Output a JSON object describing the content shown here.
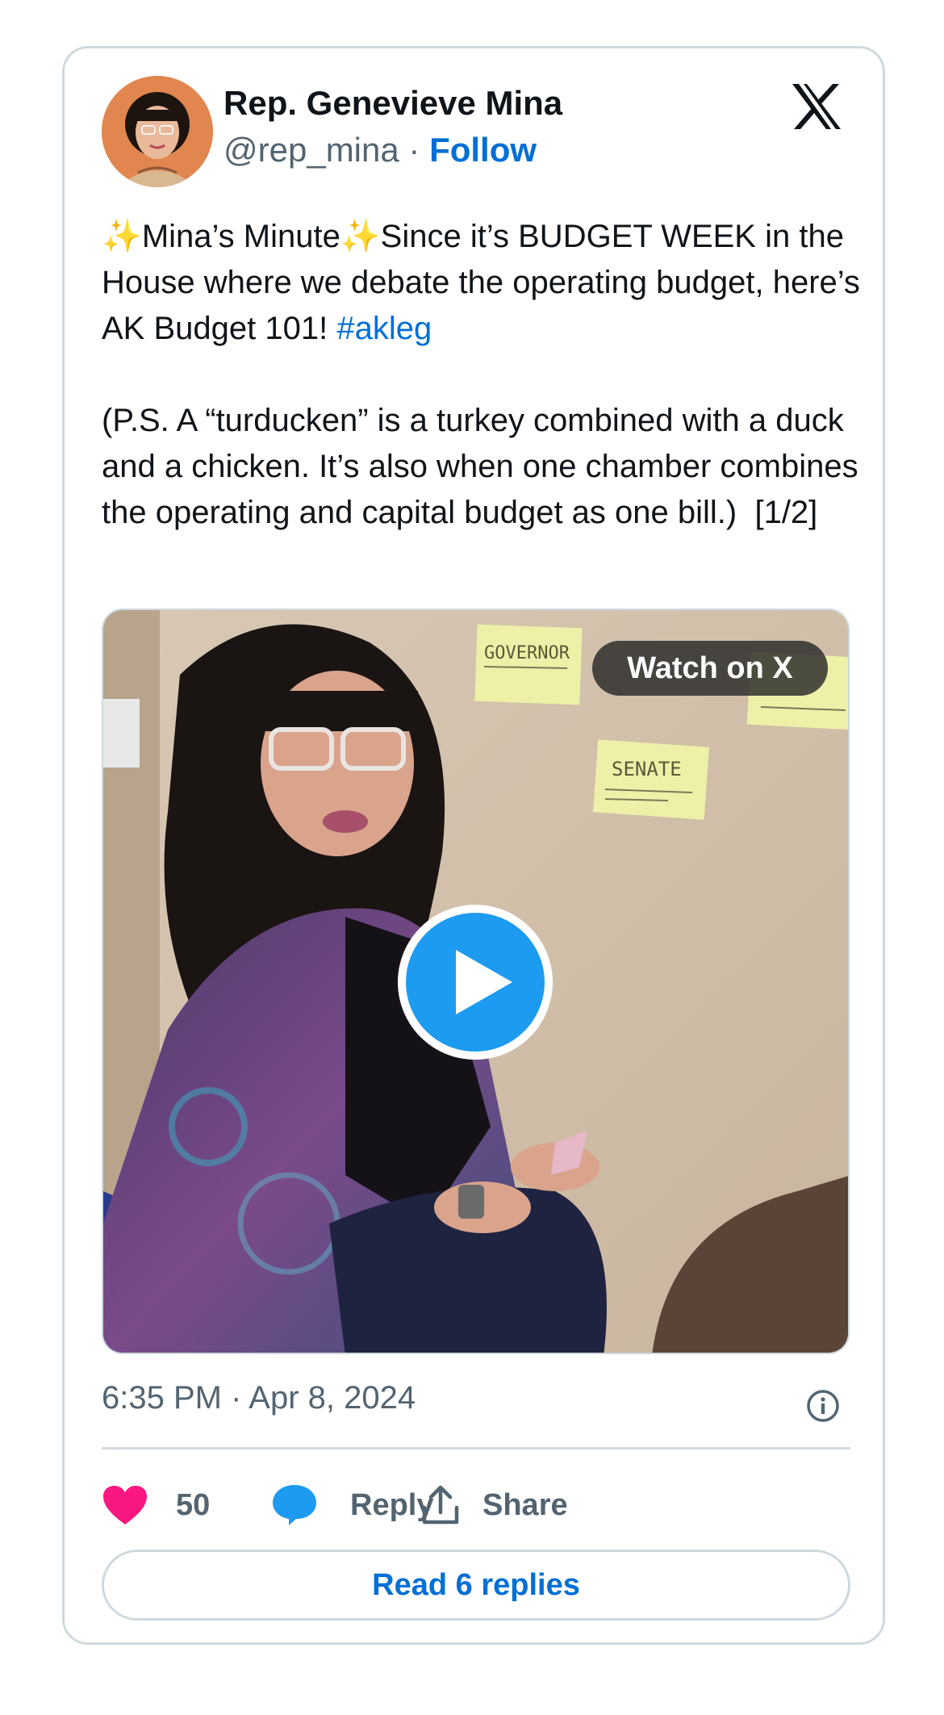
{
  "author": {
    "name": "Rep. Genevieve Mina",
    "handle": "@rep_mina",
    "separator": " · ",
    "follow_label": "Follow"
  },
  "icons": {
    "logo": "x-logo-icon",
    "play": "play-icon",
    "info": "info-icon",
    "like": "heart-icon",
    "reply": "reply-bubble-icon",
    "share": "share-upload-icon"
  },
  "tweet": {
    "sparkle": "✨",
    "part1": "Mina’s Minute",
    "part2": "Since it’s BUDGET WEEK in the House where we debate the operating budget, here’s AK Budget 101! ",
    "hashtag": "#akleg",
    "part3": "\n\n(P.S. A “turducken” is a turkey combined with a duck and a chicken. It’s also when one chamber combines the operating and capital budget as one bill.)  [1/2]"
  },
  "media": {
    "watch_label": "Watch on X",
    "sticky_notes": [
      "GOVERNOR",
      "SENATE"
    ]
  },
  "timestamp": "6:35 PM · Apr 8, 2024",
  "actions": {
    "like_count": "50",
    "reply_label": "Reply",
    "share_label": "Share"
  },
  "read_replies_label": "Read 6 replies",
  "colors": {
    "link": "#006fd6",
    "like": "#f91880",
    "reply": "#1d9bf0",
    "play": "#1d9bf0",
    "border": "#cfd9de",
    "muted": "#536471"
  }
}
